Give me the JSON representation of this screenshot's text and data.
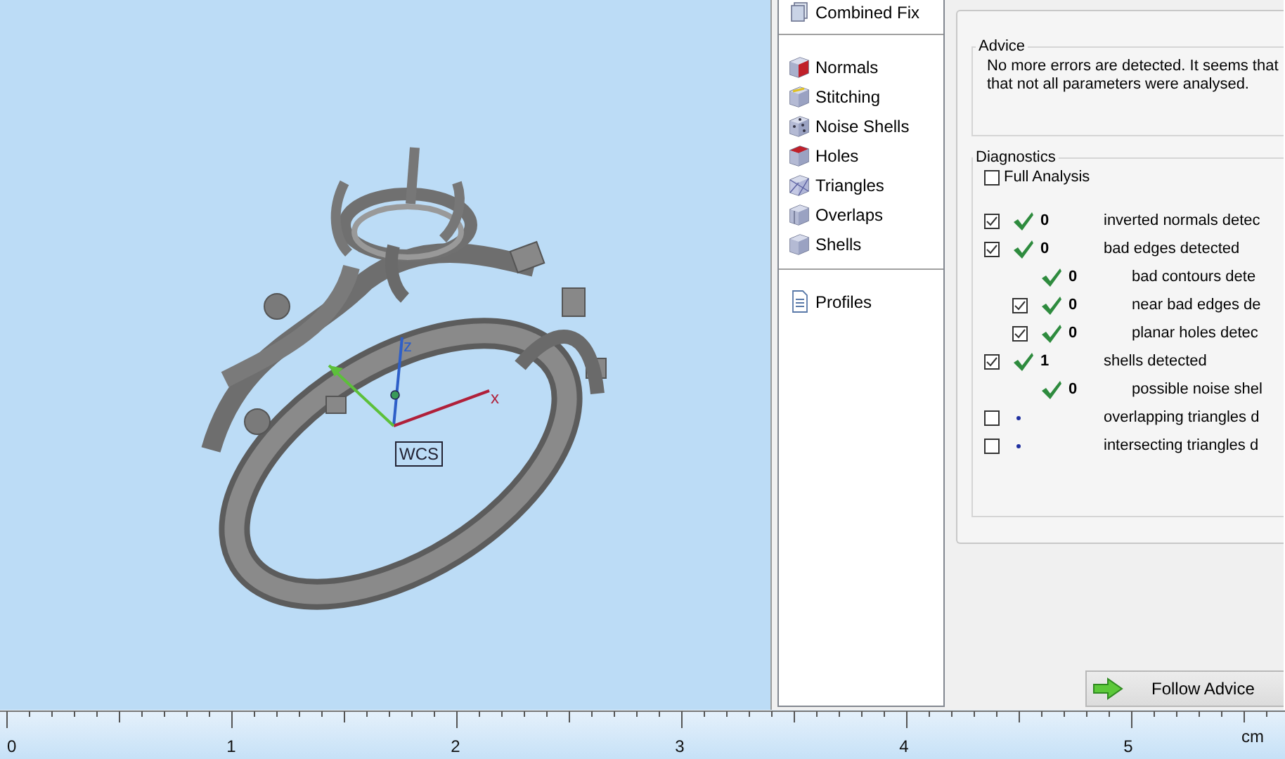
{
  "viewport": {
    "axes": [
      {
        "label": "z"
      },
      {
        "label": "x"
      }
    ],
    "wcs_label": "WCS"
  },
  "fix_list": {
    "groups": [
      {
        "items": [
          {
            "label": "Combined Fix",
            "kind": "stack"
          }
        ]
      },
      {
        "items": [
          {
            "label": "Normals",
            "kind": "cube-red-side"
          },
          {
            "label": "Stitching",
            "kind": "cube-stitch"
          },
          {
            "label": "Noise Shells",
            "kind": "dotted-cube"
          },
          {
            "label": "Holes",
            "kind": "cube-red-top"
          },
          {
            "label": "Triangles",
            "kind": "wire-cube"
          },
          {
            "label": "Overlaps",
            "kind": "cube-split"
          },
          {
            "label": "Shells",
            "kind": "cube"
          }
        ]
      },
      {
        "items": [
          {
            "label": "Profiles",
            "kind": "document"
          }
        ]
      }
    ]
  },
  "advice": {
    "title": "Advice",
    "lines": [
      "No more errors are detected. It seems that",
      "that not all parameters were analysed."
    ]
  },
  "diagnostics": {
    "title": "Diagnostics",
    "full_analysis": {
      "label": "Full Analysis",
      "checked": false
    },
    "rows": [
      {
        "kind": "check-row",
        "checked": true,
        "passed": true,
        "count": "0",
        "label": "inverted normals detec"
      },
      {
        "kind": "check-row",
        "checked": true,
        "passed": true,
        "count": "0",
        "label": "bad edges detected",
        "children": [
          {
            "kind": "plain-row",
            "passed": true,
            "count": "0",
            "label": "bad contours dete"
          },
          {
            "kind": "check-row",
            "checked": true,
            "passed": true,
            "count": "0",
            "label": "near bad edges de"
          },
          {
            "kind": "check-row",
            "checked": true,
            "passed": true,
            "count": "0",
            "label": "planar holes detec"
          }
        ]
      },
      {
        "kind": "check-row",
        "checked": true,
        "passed": true,
        "count": "1",
        "label": "shells detected",
        "children": [
          {
            "kind": "plain-row",
            "passed": true,
            "count": "0",
            "label": "possible noise shel"
          }
        ]
      },
      {
        "kind": "check-row",
        "checked": false,
        "passed": false,
        "label": "overlapping triangles d"
      },
      {
        "kind": "check-row",
        "checked": false,
        "passed": false,
        "label": "intersecting triangles d"
      }
    ]
  },
  "follow_button": {
    "label": "Follow Advice"
  },
  "ruler": {
    "labels": [
      "0",
      "1",
      "2",
      "3",
      "4",
      "5"
    ],
    "unit": "cm"
  }
}
